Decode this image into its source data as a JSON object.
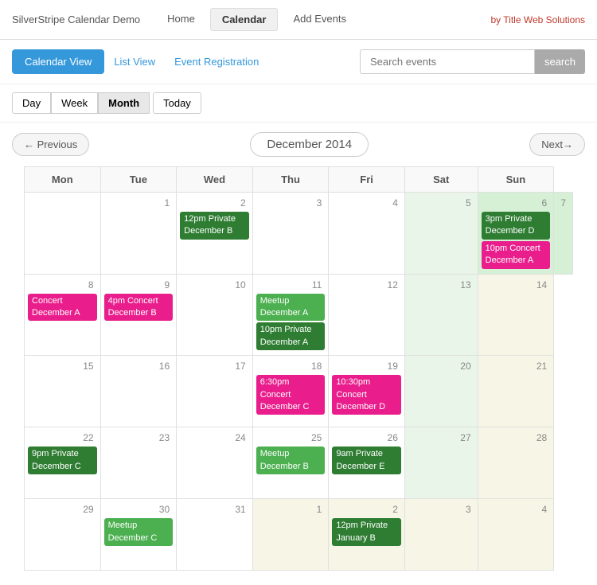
{
  "topNav": {
    "brand": "SilverStripe Calendar Demo",
    "links": [
      "Home",
      "Calendar",
      "Add Events"
    ],
    "activeLink": "Calendar",
    "byTitle": "by Title Web Solutions"
  },
  "subNav": {
    "calendarView": "Calendar View",
    "listView": "List View",
    "eventRegistration": "Event Registration",
    "searchPlaceholder": "Search events",
    "searchBtn": "search"
  },
  "viewControls": {
    "day": "Day",
    "week": "Week",
    "month": "Month",
    "today": "Today"
  },
  "calNav": {
    "prev": "← Previous",
    "title": "December 2014",
    "next": "Next→"
  },
  "calendar": {
    "headers": [
      "Mon",
      "Tue",
      "Wed",
      "Thu",
      "Fri",
      "Sat",
      "Sun"
    ],
    "weeks": [
      [
        {
          "num": "",
          "type": "normal",
          "events": []
        },
        {
          "num": "1",
          "type": "normal",
          "events": []
        },
        {
          "num": "2",
          "type": "normal",
          "events": [
            {
              "color": "dark-green",
              "text": "12pm Private December B"
            }
          ]
        },
        {
          "num": "3",
          "type": "normal",
          "events": []
        },
        {
          "num": "4",
          "type": "normal",
          "events": []
        },
        {
          "num": "5",
          "type": "light-green",
          "events": []
        },
        {
          "num": "6",
          "type": "weekend",
          "events": [
            {
              "color": "dark-green",
              "text": "3pm Private December D"
            },
            {
              "color": "pink",
              "text": "10pm Concert December A"
            }
          ]
        },
        {
          "num": "7",
          "type": "weekend",
          "events": []
        }
      ],
      [
        {
          "num": "8",
          "type": "normal",
          "events": [
            {
              "color": "pink",
              "text": "Concert December A"
            }
          ]
        },
        {
          "num": "9",
          "type": "normal",
          "events": [
            {
              "color": "pink",
              "text": "4pm Concert December B"
            }
          ]
        },
        {
          "num": "10",
          "type": "normal",
          "events": []
        },
        {
          "num": "11",
          "type": "normal",
          "events": [
            {
              "color": "green",
              "text": "Meetup December A"
            },
            {
              "color": "dark-green",
              "text": "10pm Private December A"
            }
          ]
        },
        {
          "num": "12",
          "type": "normal",
          "events": []
        },
        {
          "num": "13",
          "type": "light-green",
          "events": []
        },
        {
          "num": "14",
          "type": "other-month",
          "events": []
        }
      ],
      [
        {
          "num": "15",
          "type": "normal",
          "events": []
        },
        {
          "num": "16",
          "type": "normal",
          "events": []
        },
        {
          "num": "17",
          "type": "normal",
          "events": []
        },
        {
          "num": "18",
          "type": "normal",
          "events": [
            {
              "color": "pink",
              "text": "6:30pm Concert December C"
            }
          ]
        },
        {
          "num": "19",
          "type": "normal",
          "events": [
            {
              "color": "pink",
              "text": "10:30pm Concert December D"
            }
          ]
        },
        {
          "num": "20",
          "type": "light-green",
          "events": []
        },
        {
          "num": "21",
          "type": "other-month",
          "events": []
        }
      ],
      [
        {
          "num": "22",
          "type": "normal",
          "events": [
            {
              "color": "dark-green",
              "text": "9pm Private December C"
            }
          ]
        },
        {
          "num": "23",
          "type": "normal",
          "events": []
        },
        {
          "num": "24",
          "type": "normal",
          "events": []
        },
        {
          "num": "25",
          "type": "normal",
          "events": [
            {
              "color": "green",
              "text": "Meetup December B"
            }
          ]
        },
        {
          "num": "26",
          "type": "normal",
          "events": [
            {
              "color": "dark-green",
              "text": "9am Private December E"
            }
          ]
        },
        {
          "num": "27",
          "type": "light-green",
          "events": []
        },
        {
          "num": "28",
          "type": "other-month",
          "events": []
        }
      ],
      [
        {
          "num": "29",
          "type": "normal",
          "events": []
        },
        {
          "num": "30",
          "type": "normal",
          "events": [
            {
              "color": "green",
              "text": "Meetup December C"
            }
          ]
        },
        {
          "num": "31",
          "type": "normal",
          "events": []
        },
        {
          "num": "1",
          "type": "other-month",
          "events": []
        },
        {
          "num": "2",
          "type": "other-month",
          "events": [
            {
              "color": "dark-green",
              "text": "12pm Private January B"
            }
          ]
        },
        {
          "num": "3",
          "type": "other-month",
          "events": []
        },
        {
          "num": "4",
          "type": "other-month",
          "events": []
        }
      ]
    ]
  }
}
